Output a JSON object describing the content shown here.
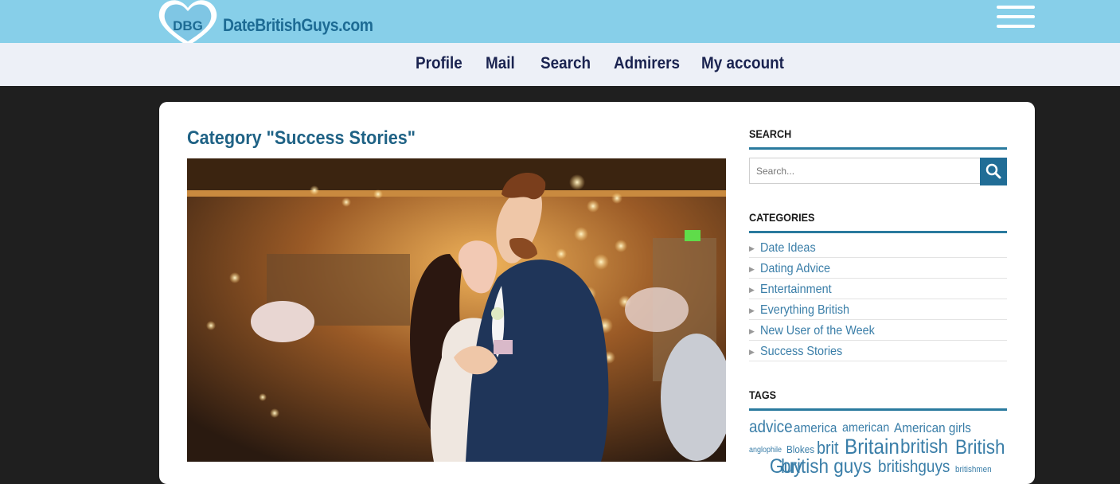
{
  "header": {
    "logo_mark": "DBG",
    "site_name": "DateBritishGuys.com",
    "menu_icon": "hamburger-icon"
  },
  "nav": {
    "items": [
      "Profile",
      "Mail",
      "Search",
      "Admirers",
      "My account"
    ]
  },
  "main": {
    "title": "Category \"Success Stories\"",
    "image_alt": "wedding-couple-dancing-photo"
  },
  "sidebar": {
    "search": {
      "heading": "SEARCH",
      "placeholder": "Search...",
      "button_icon": "search-icon"
    },
    "categories": {
      "heading": "CATEGORIES",
      "items": [
        "Date Ideas",
        "Dating Advice",
        "Entertainment",
        "Everything British",
        "New User of the Week",
        "Success Stories"
      ]
    },
    "tags": {
      "heading": "TAGS",
      "items": [
        "advice",
        "america",
        "american",
        "American girls",
        "anglophile",
        "Blokes",
        "brit",
        "Britain",
        "british",
        "British Guy",
        "british guys",
        "britishguys",
        "britishmen"
      ]
    }
  },
  "colors": {
    "header_bg": "#87cfe9",
    "nav_bg": "#edf0f7",
    "accent": "#216d96",
    "link": "#3a7ea8"
  }
}
